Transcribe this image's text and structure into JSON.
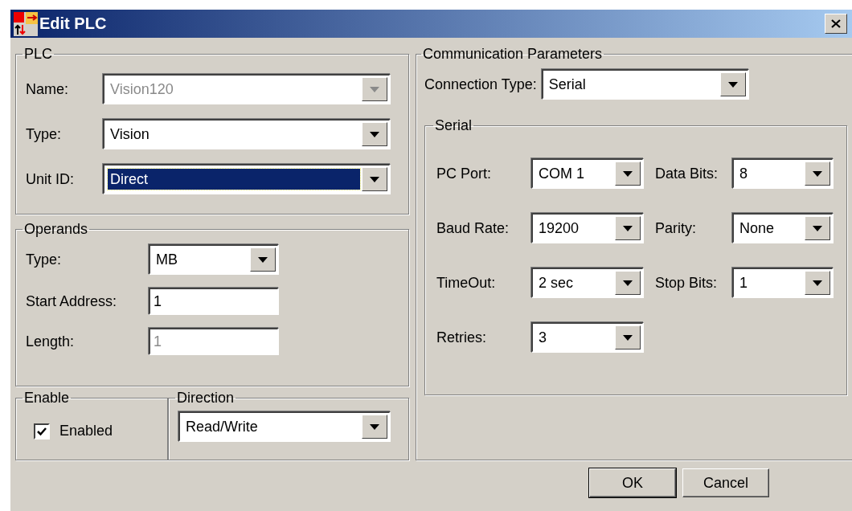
{
  "window": {
    "title": "Edit PLC"
  },
  "plc": {
    "title": "PLC",
    "fields": [
      {
        "label": "Name:",
        "value": "Vision120",
        "disabled": true,
        "focused": false
      },
      {
        "label": "Type:",
        "value": "Vision",
        "disabled": false,
        "focused": false
      },
      {
        "label": "Unit ID:",
        "value": "Direct",
        "disabled": false,
        "focused": true
      }
    ]
  },
  "operands": {
    "title": "Operands",
    "fields": [
      {
        "kind": "dropdown",
        "label": "Type:",
        "value": "MB",
        "disabled": false
      },
      {
        "kind": "text",
        "label": "Start Address:",
        "value": "1",
        "disabled": false
      },
      {
        "kind": "text",
        "label": "Length:",
        "value": "1",
        "disabled": true
      }
    ]
  },
  "enable": {
    "title": "Enable",
    "checkbox": {
      "label": "Enabled",
      "checked": true
    }
  },
  "direction": {
    "title": "Direction",
    "value": "Read/Write"
  },
  "communication": {
    "title": "Communication Parameters",
    "connection_type": {
      "label": "Connection Type:",
      "value": "Serial"
    },
    "serial": {
      "title": "Serial",
      "fields": [
        {
          "label": "PC Port:",
          "value": "COM 1"
        },
        {
          "label": "Data Bits:",
          "value": "8"
        },
        {
          "label": "Baud Rate:",
          "value": "19200"
        },
        {
          "label": "Parity:",
          "value": "None"
        },
        {
          "label": "TimeOut:",
          "value": "2 sec"
        },
        {
          "label": "Stop Bits:",
          "value": "1"
        },
        {
          "label": "Retries:",
          "value": "3"
        }
      ]
    }
  },
  "buttons": [
    {
      "label": "OK",
      "default": true
    },
    {
      "label": "Cancel",
      "default": false
    }
  ]
}
